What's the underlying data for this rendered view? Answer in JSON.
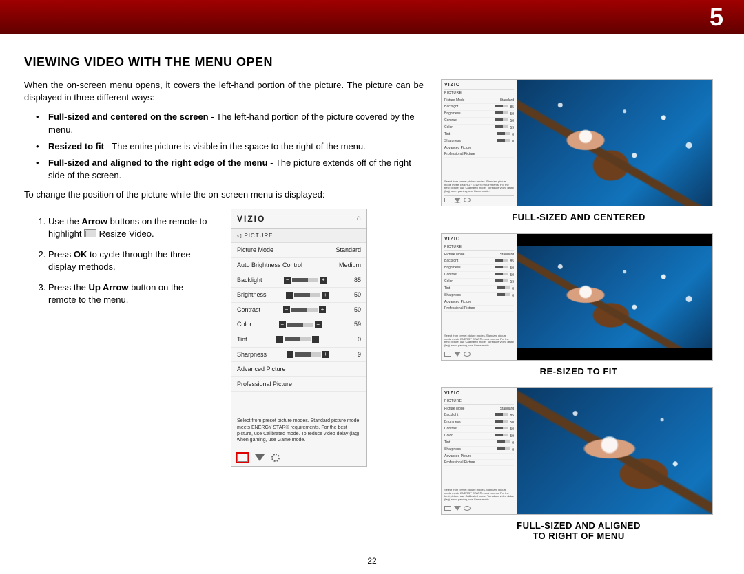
{
  "chapter_number": "5",
  "section_title": "VIEWING VIDEO WITH THE MENU OPEN",
  "intro": "When the on-screen menu opens, it covers the left-hand portion of the picture. The picture can be displayed in three different ways:",
  "bullets": [
    {
      "bold": "Full-sized and centered on the screen",
      "rest": " - The left-hand portion of the picture covered by the menu."
    },
    {
      "bold": "Resized to fit",
      "rest": " - The entire picture is visible in the space to the right of the menu."
    },
    {
      "bold": "Full-sized and aligned to the right edge of the menu",
      "rest": " - The picture extends off of the right side of the screen."
    }
  ],
  "transition": "To change the position of the picture while the on-screen menu is displayed:",
  "steps": [
    {
      "pre": "Use the ",
      "bold": "Arrow",
      "mid": " buttons on the remote to highlight ",
      "tail": " Resize Video."
    },
    {
      "pre": "Press ",
      "bold": "OK",
      "mid": " to cycle through the three display methods.",
      "tail": ""
    },
    {
      "pre": "Press the ",
      "bold": "Up Arrow",
      "mid": " button on the remote to the menu.",
      "tail": ""
    }
  ],
  "osd": {
    "brand": "VIZIO",
    "category": "PICTURE",
    "rows_kv": [
      {
        "label": "Picture Mode",
        "value": "Standard"
      },
      {
        "label": "Auto Brightness Control",
        "value": "Medium"
      }
    ],
    "rows_slider": [
      {
        "label": "Backlight",
        "value": "85"
      },
      {
        "label": "Brightness",
        "value": "50"
      },
      {
        "label": "Contrast",
        "value": "50"
      },
      {
        "label": "Color",
        "value": "59"
      },
      {
        "label": "Tint",
        "value": "0"
      },
      {
        "label": "Sharpness",
        "value": "9"
      }
    ],
    "rows_sub": [
      "Advanced Picture",
      "Professional Picture"
    ],
    "hint": "Select from preset picture modes. Standard picture mode meets ENERGY STAR® requirements. For the best picture, use Calibrated mode. To reduce video delay (lag) when gaming, use Game mode."
  },
  "mini_rows": [
    {
      "label": "Picture Mode",
      "value": "Standard"
    },
    {
      "label": "Backlight",
      "slider": true,
      "value": "85"
    },
    {
      "label": "Brightness",
      "slider": true,
      "value": "50"
    },
    {
      "label": "Contrast",
      "slider": true,
      "value": "50"
    },
    {
      "label": "Color",
      "slider": true,
      "value": "59"
    },
    {
      "label": "Tint",
      "slider": true,
      "value": "0"
    },
    {
      "label": "Sharpness",
      "slider": true,
      "value": "0"
    },
    {
      "label": "Advanced Picture",
      "value": ""
    },
    {
      "label": "Professional Picture",
      "value": ""
    }
  ],
  "mini_hint": "Select from preset picture modes. Standard picture mode meets ENERGY STAR® requirements. For the best picture, use Calibrated mode. To reduce video delay (lag) when gaming, use Game mode.",
  "captions": {
    "centered": "FULL-SIZED AND CENTERED",
    "resized": "RE-SIZED TO FIT",
    "aligned_l1": "FULL-SIZED AND ALIGNED",
    "aligned_l2": "TO RIGHT OF MENU"
  },
  "page_number": "22"
}
